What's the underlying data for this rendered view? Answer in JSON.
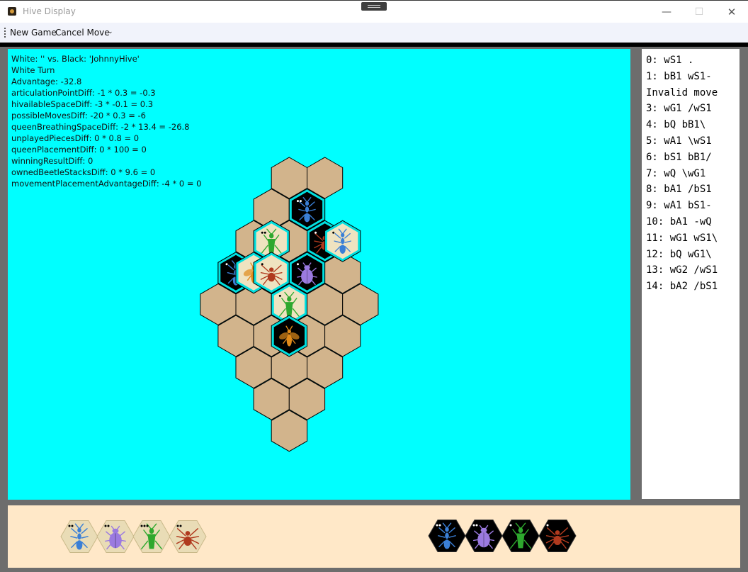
{
  "window": {
    "title": "Hive Display",
    "minimize": "—",
    "maximize": "☐",
    "close": "✕"
  },
  "menu": {
    "new_game": "New Game",
    "cancel_move": "Cancel Move",
    "overflow": "⌄"
  },
  "stats": [
    "White: '' vs. Black: 'JohnnyHive'",
    "White Turn",
    "Advantage: -32.8",
    "articulationPointDiff: -1 * 0.3 = -0.3",
    "hivailableSpaceDiff: -3 * -0.1 = 0.3",
    "possibleMovesDiff: -20 * 0.3 = -6",
    "queenBreathingSpaceDiff: -2 * 13.4 = -26.8",
    "unplayedPiecesDiff: 0 * 0.8 = 0",
    "queenPlacementDiff: 0 * 100 = 0",
    "winningResultDiff: 0",
    "ownedBeetleStacksDiff: 0 * 9.6 = 0",
    "movementPlacementAdvantageDiff: -4 * 0 = 0"
  ],
  "moves": [
    "0: wS1 .",
    "1: bB1 wS1-",
    "Invalid move",
    "3: wG1 /wS1",
    "4: bQ bB1\\",
    "5: wA1 \\wS1",
    "6: bS1 bB1/",
    "7: wQ \\wG1",
    "8: bA1 /bS1",
    "9: wA1 bS1-",
    "10: bA1 -wQ",
    "11: wG1 wS1\\",
    "12: bQ wG1\\",
    "13: wG2 /wS1",
    "14: bA2 /bS1"
  ],
  "colors": {
    "board_bg": "#00ffff",
    "empty_hex": "#d2b48c",
    "white_piece": "#efe3c0",
    "black_piece": "#000000",
    "highlight": "#00e0e0",
    "hand_bg": "#ffe8c8",
    "ant": "#3a7fd6",
    "beetle": "#9b7ae0",
    "grasshopper": "#2ea82e",
    "spider": "#b03a1e",
    "queen": "#e08a1a"
  },
  "board": {
    "empty_cells": [
      [
        9,
        0
      ],
      [
        11,
        0
      ],
      [
        8,
        1
      ],
      [
        10,
        1
      ],
      [
        7,
        2
      ],
      [
        9,
        2
      ],
      [
        11,
        2
      ],
      [
        6,
        3
      ],
      [
        8,
        3
      ],
      [
        10,
        3
      ],
      [
        12,
        3
      ],
      [
        5,
        4
      ],
      [
        7,
        4
      ],
      [
        9,
        4
      ],
      [
        11,
        4
      ],
      [
        13,
        4
      ],
      [
        6,
        5
      ],
      [
        8,
        5
      ],
      [
        10,
        5
      ],
      [
        12,
        5
      ],
      [
        7,
        6
      ],
      [
        9,
        6
      ],
      [
        11,
        6
      ],
      [
        8,
        7
      ],
      [
        10,
        7
      ],
      [
        9,
        8
      ]
    ],
    "pieces": [
      {
        "col": 10,
        "row": 1,
        "color": "black",
        "bug": "ant",
        "dots": 2
      },
      {
        "col": 8,
        "row": 2,
        "color": "white",
        "bug": "grasshopper",
        "dots": 2
      },
      {
        "col": 11,
        "row": 2,
        "color": "black",
        "bug": "spider",
        "dots": 1
      },
      {
        "col": 12,
        "row": 2,
        "color": "white",
        "bug": "ant",
        "dots": 1
      },
      {
        "col": 6,
        "row": 3,
        "color": "black",
        "bug": "ant",
        "dots": 1
      },
      {
        "col": 7,
        "row": 3,
        "color": "white",
        "bug": "queen",
        "dots": 0
      },
      {
        "col": 8,
        "row": 3,
        "color": "white",
        "bug": "spider",
        "dots": 1
      },
      {
        "col": 10,
        "row": 3,
        "color": "black",
        "bug": "beetle",
        "dots": 1
      },
      {
        "col": 9,
        "row": 4,
        "color": "white",
        "bug": "grasshopper",
        "dots": 1
      },
      {
        "col": 9,
        "row": 5,
        "color": "black",
        "bug": "queen",
        "dots": 0
      }
    ]
  },
  "hand": {
    "white": [
      {
        "bug": "ant",
        "dots": 2
      },
      {
        "bug": "beetle",
        "dots": 2
      },
      {
        "bug": "grasshopper",
        "dots": 3
      },
      {
        "bug": "spider",
        "dots": 2
      }
    ],
    "black": [
      {
        "bug": "ant",
        "dots": 2
      },
      {
        "bug": "beetle",
        "dots": 2
      },
      {
        "bug": "grasshopper",
        "dots": 1
      },
      {
        "bug": "spider",
        "dots": 1
      }
    ]
  }
}
